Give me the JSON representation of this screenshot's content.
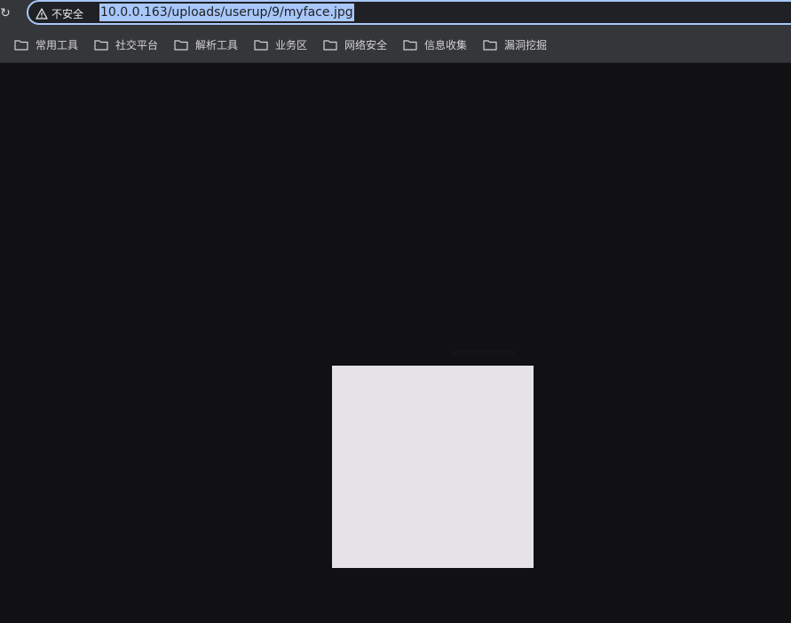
{
  "omnibox": {
    "security_label": "不安全",
    "url": "10.0.0.163/uploads/userup/9/myface.jpg"
  },
  "bookmarks": [
    {
      "label": "常用工具",
      "icon": "folder-icon"
    },
    {
      "label": "社交平台",
      "icon": "folder-icon"
    },
    {
      "label": "解析工具",
      "icon": "folder-icon"
    },
    {
      "label": "业务区",
      "icon": "folder-icon"
    },
    {
      "label": "网络安全",
      "icon": "folder-icon"
    },
    {
      "label": "信息收集",
      "icon": "folder-icon"
    },
    {
      "label": "漏洞挖掘",
      "icon": "folder-icon"
    }
  ],
  "colors": {
    "toolbar": "#35363a",
    "page_background": "#111012",
    "image_fill": "#e5e3e6",
    "url_selection": "#a8c7fa"
  }
}
